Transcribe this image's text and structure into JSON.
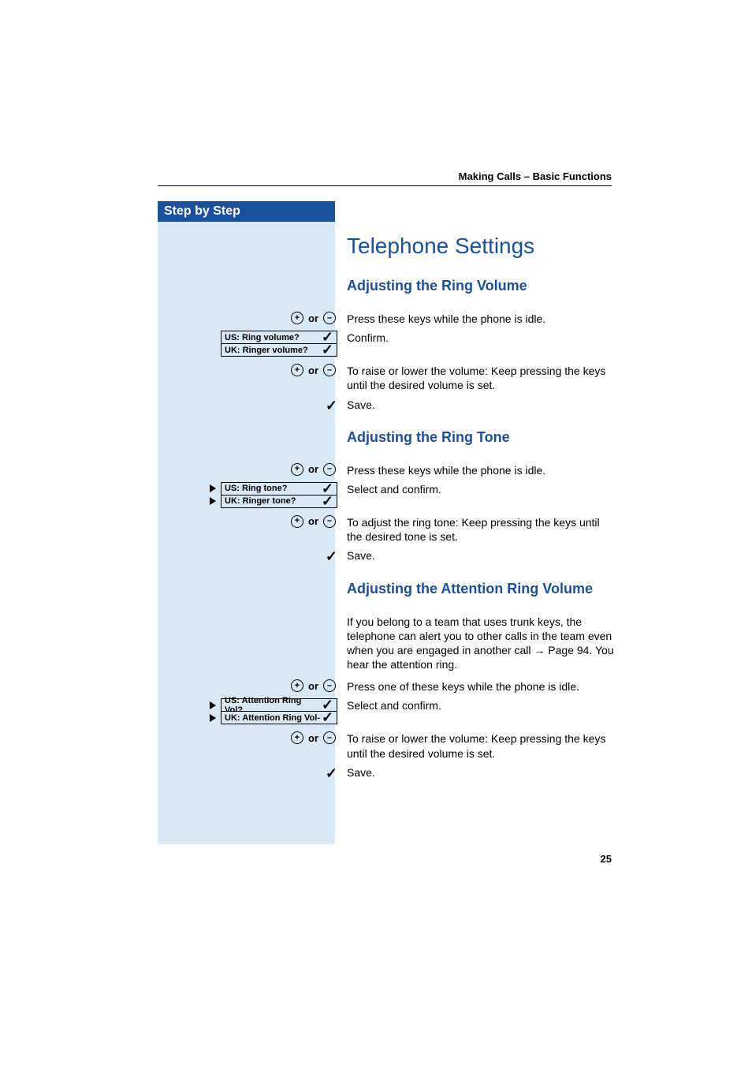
{
  "header": "Making Calls – Basic Functions",
  "sidebar_title": "Step by Step",
  "page_number": "25",
  "h1": "Telephone Settings",
  "sections": {
    "ring_volume": {
      "title": "Adjusting the Ring Volume",
      "step1_text": "Press these keys while the phone is idle.",
      "display_us": "US: Ring volume?",
      "display_uk": "UK: Ringer volume?",
      "step2_text": "Confirm.",
      "step3_text": "To raise or lower the volume: Keep pressing the keys until the desired volume is set.",
      "step4_text": "Save."
    },
    "ring_tone": {
      "title": "Adjusting the Ring Tone",
      "step1_text": "Press these keys while the phone is idle.",
      "display_us": "US: Ring tone?",
      "display_uk": "UK: Ringer tone?",
      "step2_text": "Select and confirm.",
      "step3_text": "To adjust the ring tone: Keep pressing the keys until the desired tone is set.",
      "step4_text": "Save."
    },
    "attention": {
      "title": "Adjusting the Attention Ring Volume",
      "intro_part1": "If you belong to a team that uses trunk keys, the telephone can alert you to other calls in the team even when you are engaged in another call ",
      "intro_ref": "→ Page 94",
      "intro_part2": ". You hear the attention ring.",
      "step1_text": "Press one of these keys while the phone is idle.",
      "display_us": "US: Attention Ring Vol?",
      "display_uk": "UK: Attention Ring Vol-",
      "step2_text": "Select and confirm.",
      "step3_text": "To raise or lower the volume: Keep pressing the keys until the desired volume is set.",
      "step4_text": "Save."
    }
  },
  "labels": {
    "or": "or",
    "plus": "+",
    "minus": "–"
  }
}
